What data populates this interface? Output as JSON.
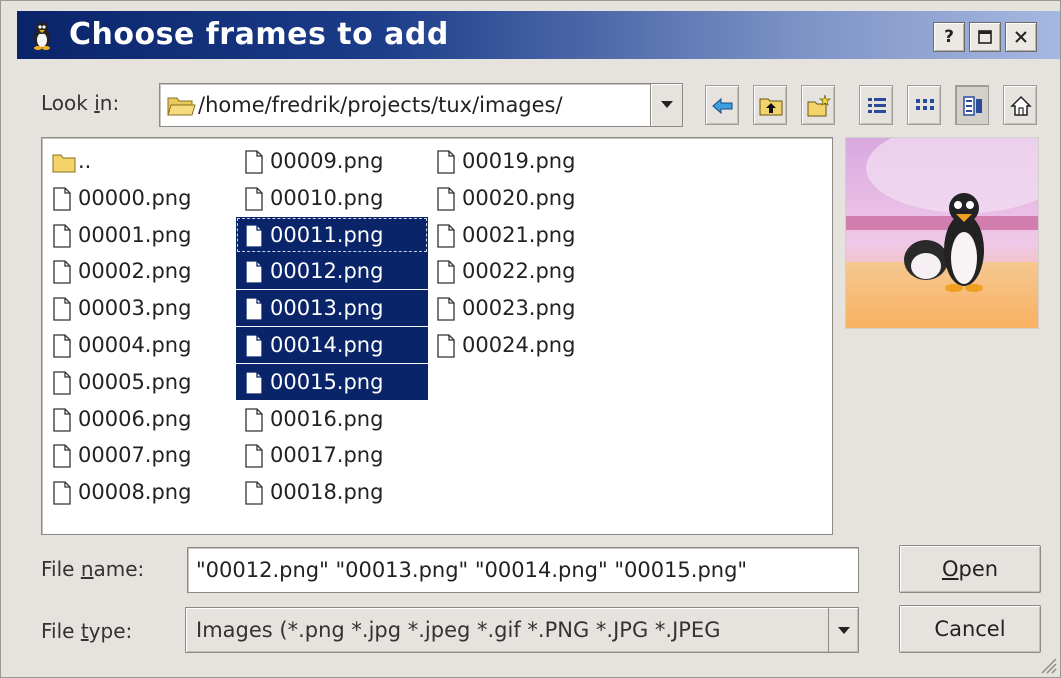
{
  "window": {
    "title": "Choose frames to add",
    "buttons": {
      "help": "?",
      "maximize": "□",
      "close": "×"
    }
  },
  "look_in": {
    "label_pre": "Look ",
    "label_key": "i",
    "label_post": "n:",
    "path": "/home/fredrik/projects/tux/images/"
  },
  "toolbar": {
    "icons": [
      "back-icon",
      "parent-folder-icon",
      "new-folder-icon",
      "list-view-icon",
      "icon-view-icon",
      "detail-view-icon",
      "home-icon"
    ]
  },
  "files": {
    "parent": "..",
    "col1": [
      "00000.png",
      "00001.png",
      "00002.png",
      "00003.png",
      "00004.png",
      "00005.png",
      "00006.png",
      "00007.png",
      "00008.png"
    ],
    "col2": [
      "00009.png",
      "00010.png",
      "00011.png",
      "00012.png",
      "00013.png",
      "00014.png",
      "00015.png",
      "00016.png",
      "00017.png",
      "00018.png"
    ],
    "col3": [
      "00019.png",
      "00020.png",
      "00021.png",
      "00022.png",
      "00023.png",
      "00024.png"
    ],
    "selected": [
      "00011.png",
      "00012.png",
      "00013.png",
      "00014.png",
      "00015.png"
    ],
    "focused": "00011.png"
  },
  "file_name": {
    "label_pre": "File ",
    "label_key": "n",
    "label_post": "ame:",
    "value": "\"00012.png\" \"00013.png\" \"00014.png\" \"00015.png\""
  },
  "file_type": {
    "label_pre": "File ",
    "label_key": "t",
    "label_post": "ype:",
    "value": "Images (*.png *.jpg *.jpeg  *.gif *.PNG *.JPG *.JPEG"
  },
  "actions": {
    "open_key": "O",
    "open_rest": "pen",
    "cancel": "Cancel"
  },
  "colors": {
    "selection": "#0a246a",
    "titlebar": "#0a246a",
    "background": "#e6e3df"
  }
}
